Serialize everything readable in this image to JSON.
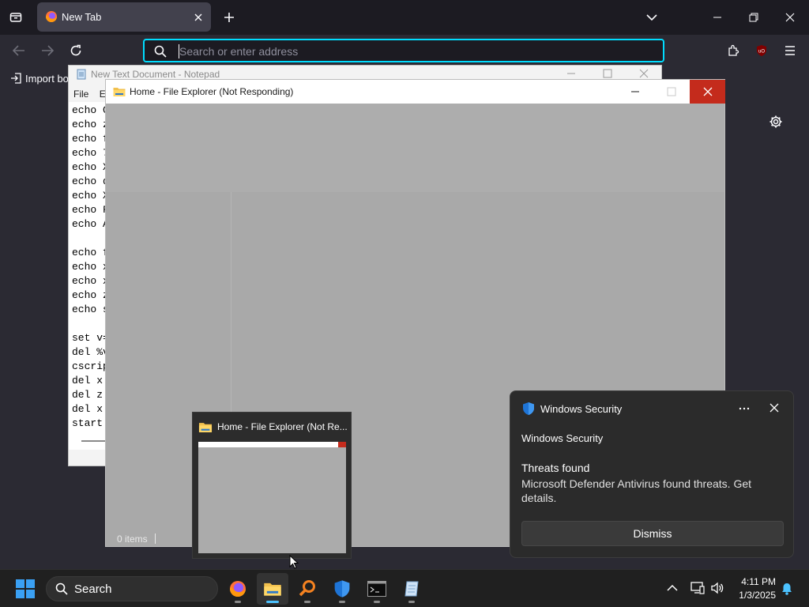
{
  "firefox": {
    "tab_title": "New Tab",
    "url_placeholder": "Search or enter address",
    "bookmark_import": "Import bo"
  },
  "notepad": {
    "title": "New Text Document - Notepad",
    "menu": [
      "File",
      "Ed"
    ],
    "lines": [
      "echo C",
      "echo z",
      "echo f",
      "echo 7",
      "echo X",
      "echo d",
      "echo X",
      "echo F",
      "echo A",
      "",
      "echo f",
      "echo x",
      "echo x",
      "echo z",
      "echo s",
      "",
      "set v=",
      "del %v",
      "cscrip",
      "del x.",
      "del z.",
      "del x ",
      "start "
    ]
  },
  "explorer": {
    "title": "Home - File Explorer (Not Responding)",
    "status": "0 items"
  },
  "thumbnail": {
    "title": "Home - File Explorer (Not Re..."
  },
  "notification": {
    "app_name": "Windows Security",
    "header": "Windows Security",
    "heading": "Threats found",
    "body": "Microsoft Defender Antivirus found threats. Get details.",
    "dismiss_label": "Dismiss"
  },
  "taskbar": {
    "search_label": "Search",
    "time": "4:11 PM",
    "date": "1/3/2025",
    "apps": [
      "firefox-icon",
      "file-explorer-icon",
      "search-tool-icon",
      "windows-security-icon",
      "terminal-icon",
      "notepad-icon"
    ]
  },
  "colors": {
    "accent": "#00ddff",
    "close_red": "#c42b1c",
    "taskbar_active": "#4cc2ff"
  }
}
